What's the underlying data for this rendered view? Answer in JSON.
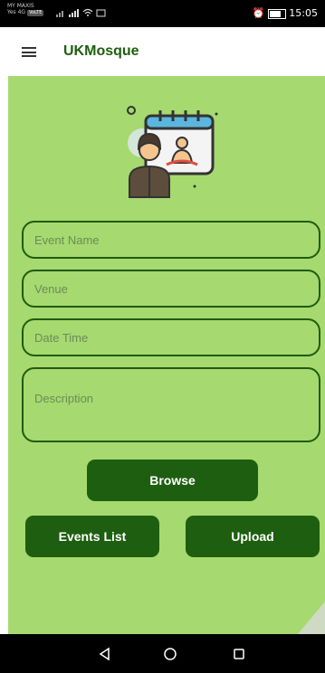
{
  "status_bar": {
    "carrier": "MY MAXIS",
    "network": "Yes 4G",
    "badge": "VoLTE",
    "signal": "… …",
    "time": "15:05"
  },
  "app_bar": {
    "title": "UKMosque"
  },
  "form": {
    "event_name_placeholder": "Event Name",
    "venue_placeholder": "Venue",
    "date_time_placeholder": "Date Time",
    "description_placeholder": "Description"
  },
  "buttons": {
    "browse": "Browse",
    "events_list": "Events List",
    "upload": "Upload"
  },
  "colors": {
    "background": "#a6d96f",
    "accent": "#1e5e10",
    "title": "#1d5f0e"
  },
  "icons": [
    "menu-icon",
    "event-calendar-person-icon",
    "back-icon",
    "home-icon",
    "recents-icon"
  ]
}
